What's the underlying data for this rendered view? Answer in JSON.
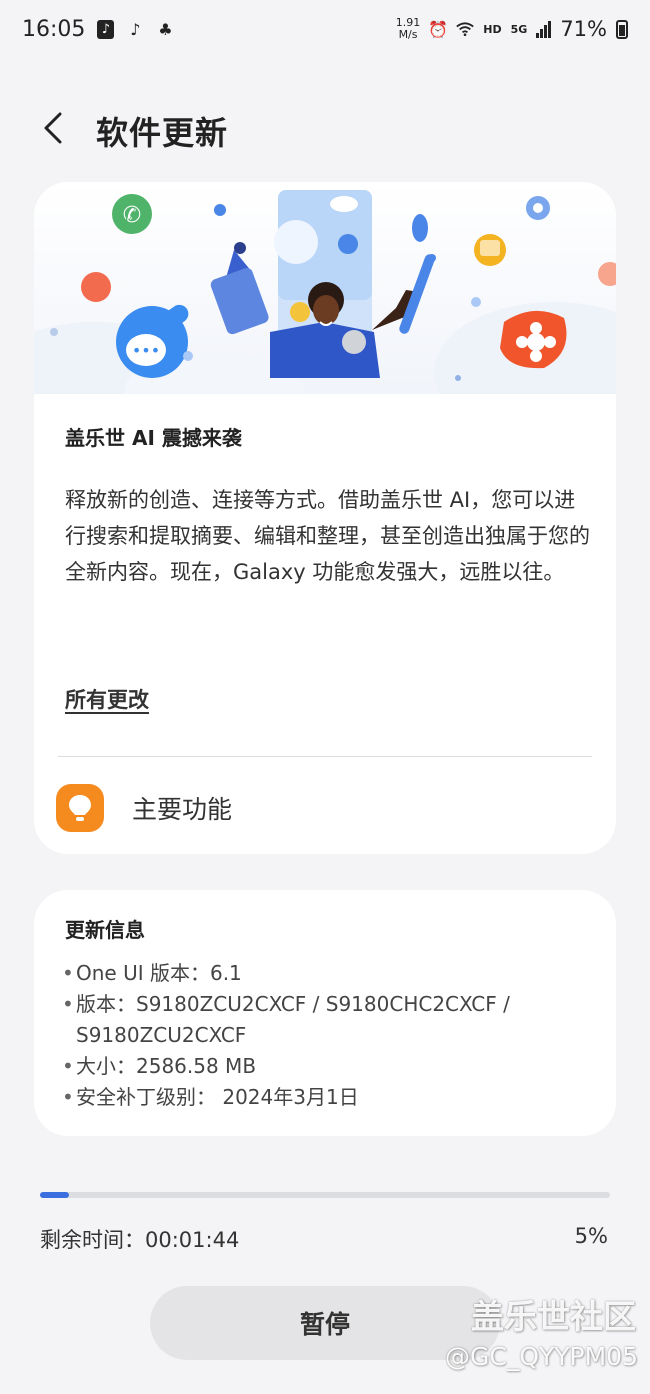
{
  "status_bar": {
    "time": "16:05",
    "speed_value": "1.91",
    "speed_unit": "M/s",
    "hd_label": "HD",
    "network_label": "5G",
    "battery": "71%"
  },
  "header": {
    "title": "软件更新"
  },
  "feature": {
    "title": "盖乐世 AI 震撼来袭",
    "description": "释放新的创造、连接等方式。借助盖乐世 AI，您可以进行搜索和提取摘要、编辑和整理，甚至创造出独属于您的全新内容。现在，Galaxy 功能愈发强大，远胜以往。",
    "all_changes_link": "所有更改",
    "main_features_label": "主要功能"
  },
  "update_info": {
    "title": "更新信息",
    "items": [
      "One UI 版本：6.1",
      "版本：S9180ZCU2CXCF / S9180CHC2CXCF / S9180ZCU2CXCF",
      "大小：2586.58 MB",
      "安全补丁级别： 2024年3月1日"
    ]
  },
  "download": {
    "progress": 0.05,
    "remaining_label": "剩余时间：00:01:44",
    "percent_label": "5%",
    "pause_button": "暂停"
  },
  "watermark": {
    "community": "盖乐世社区",
    "handle": "@GC_QYYPM05"
  },
  "colors": {
    "accent": "#3b6fe0",
    "bulb": "#f58a1f",
    "background": "#f4f4f6"
  }
}
